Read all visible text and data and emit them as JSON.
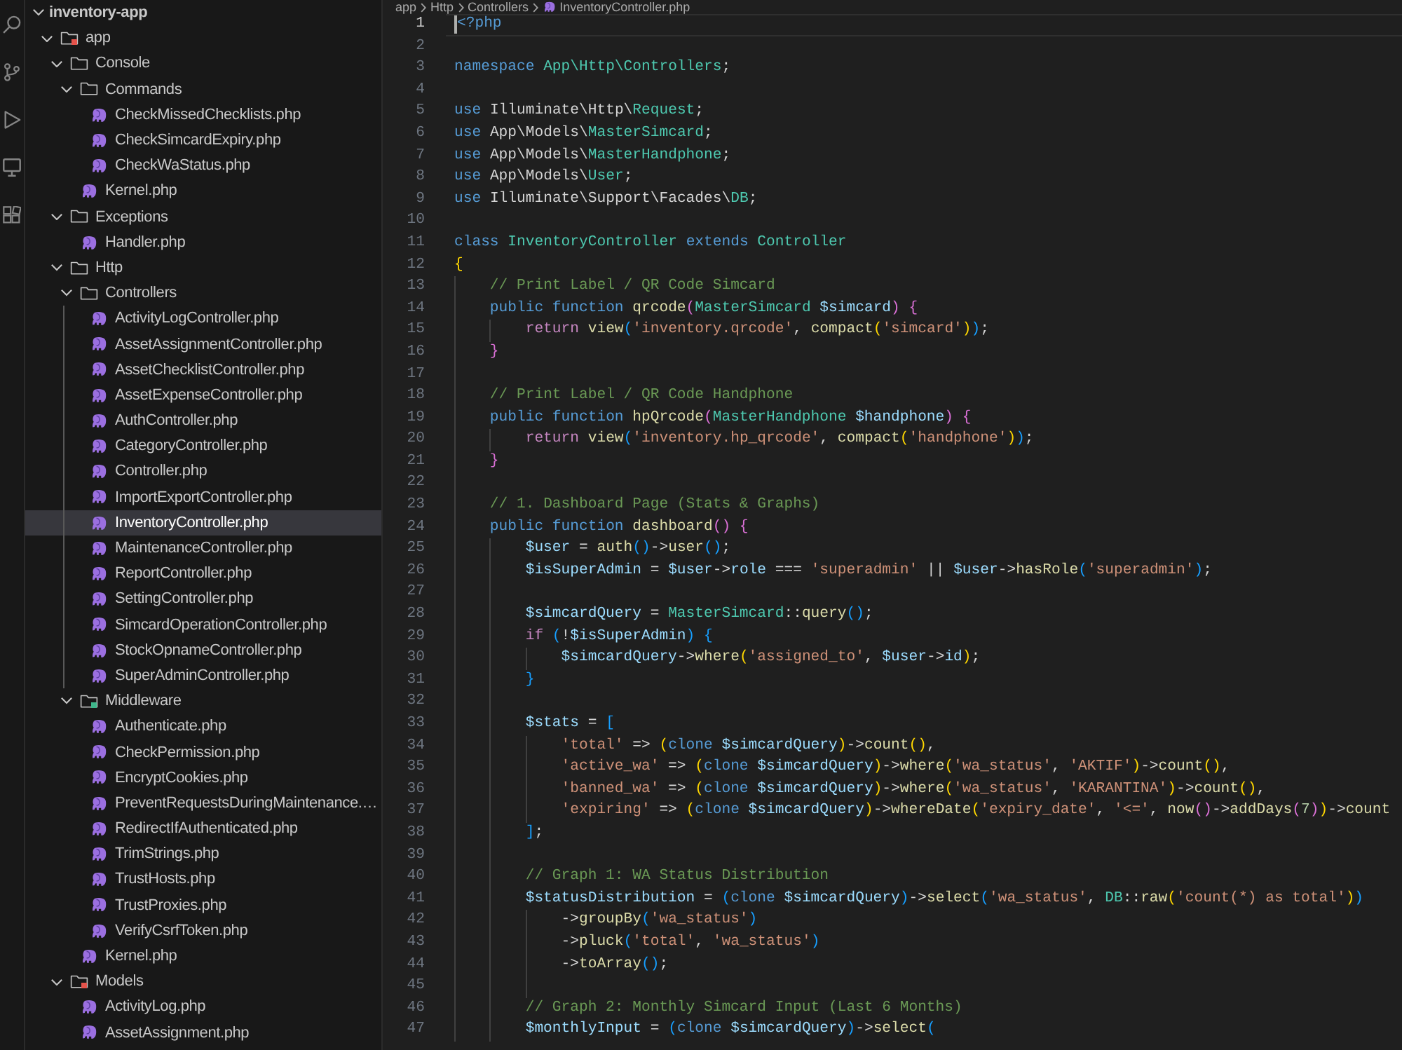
{
  "explorer": {
    "workspace": {
      "name": "inventory-app",
      "expanded": true
    },
    "tree": [
      {
        "name": "app",
        "kind": "folder",
        "expanded": true,
        "selected": false,
        "color": "#e5534b",
        "children": [
          {
            "name": "Console",
            "kind": "folder",
            "expanded": true,
            "selected": false,
            "children": [
              {
                "name": "Commands",
                "kind": "folder",
                "expanded": true,
                "selected": false,
                "children": [
                  {
                    "name": "CheckMissedChecklists.php",
                    "kind": "file",
                    "selected": false
                  },
                  {
                    "name": "CheckSimcardExpiry.php",
                    "kind": "file",
                    "selected": false
                  },
                  {
                    "name": "CheckWaStatus.php",
                    "kind": "file",
                    "selected": false
                  }
                ]
              },
              {
                "name": "Kernel.php",
                "kind": "file",
                "selected": false
              }
            ]
          },
          {
            "name": "Exceptions",
            "kind": "folder",
            "expanded": true,
            "selected": false,
            "children": [
              {
                "name": "Handler.php",
                "kind": "file",
                "selected": false
              }
            ]
          },
          {
            "name": "Http",
            "kind": "folder",
            "expanded": true,
            "selected": false,
            "children": [
              {
                "name": "Controllers",
                "kind": "folder",
                "expanded": true,
                "selected": false,
                "children": [
                  {
                    "name": "ActivityLogController.php",
                    "kind": "file",
                    "selected": false
                  },
                  {
                    "name": "AssetAssignmentController.php",
                    "kind": "file",
                    "selected": false
                  },
                  {
                    "name": "AssetChecklistController.php",
                    "kind": "file",
                    "selected": false
                  },
                  {
                    "name": "AssetExpenseController.php",
                    "kind": "file",
                    "selected": false
                  },
                  {
                    "name": "AuthController.php",
                    "kind": "file",
                    "selected": false
                  },
                  {
                    "name": "CategoryController.php",
                    "kind": "file",
                    "selected": false
                  },
                  {
                    "name": "Controller.php",
                    "kind": "file",
                    "selected": false
                  },
                  {
                    "name": "ImportExportController.php",
                    "kind": "file",
                    "selected": false
                  },
                  {
                    "name": "InventoryController.php",
                    "kind": "file",
                    "selected": true
                  },
                  {
                    "name": "MaintenanceController.php",
                    "kind": "file",
                    "selected": false
                  },
                  {
                    "name": "ReportController.php",
                    "kind": "file",
                    "selected": false
                  },
                  {
                    "name": "SettingController.php",
                    "kind": "file",
                    "selected": false
                  },
                  {
                    "name": "SimcardOperationController.php",
                    "kind": "file",
                    "selected": false
                  },
                  {
                    "name": "StockOpnameController.php",
                    "kind": "file",
                    "selected": false
                  },
                  {
                    "name": "SuperAdminController.php",
                    "kind": "file",
                    "selected": false
                  }
                ]
              },
              {
                "name": "Middleware",
                "kind": "folder",
                "expanded": true,
                "selected": false,
                "color": "#3fb68b",
                "children": [
                  {
                    "name": "Authenticate.php",
                    "kind": "file",
                    "selected": false
                  },
                  {
                    "name": "CheckPermission.php",
                    "kind": "file",
                    "selected": false
                  },
                  {
                    "name": "EncryptCookies.php",
                    "kind": "file",
                    "selected": false
                  },
                  {
                    "name": "PreventRequestsDuringMaintenance.…",
                    "kind": "file",
                    "selected": false
                  },
                  {
                    "name": "RedirectIfAuthenticated.php",
                    "kind": "file",
                    "selected": false
                  },
                  {
                    "name": "TrimStrings.php",
                    "kind": "file",
                    "selected": false
                  },
                  {
                    "name": "TrustHosts.php",
                    "kind": "file",
                    "selected": false
                  },
                  {
                    "name": "TrustProxies.php",
                    "kind": "file",
                    "selected": false
                  },
                  {
                    "name": "VerifyCsrfToken.php",
                    "kind": "file",
                    "selected": false
                  }
                ]
              },
              {
                "name": "Kernel.php",
                "kind": "file",
                "selected": false
              }
            ]
          },
          {
            "name": "Models",
            "kind": "folder",
            "expanded": true,
            "selected": false,
            "color": "#e5534b",
            "children": [
              {
                "name": "ActivityLog.php",
                "kind": "file",
                "selected": false
              },
              {
                "name": "AssetAssignment.php",
                "kind": "file",
                "selected": false
              }
            ]
          }
        ]
      }
    ]
  },
  "editor": {
    "breadcrumb": [
      "app",
      "Http",
      "Controllers",
      "InventoryController.php"
    ],
    "lines": [
      {
        "number": "1",
        "current": true,
        "tokens": [
          {
            "kind": "keyword",
            "text": "<?php"
          }
        ]
      },
      {
        "number": "2",
        "current": false
      },
      {
        "number": "3",
        "current": false,
        "tokens": [
          {
            "kind": "keyword",
            "text": "namespace "
          },
          {
            "kind": "type",
            "text": "App\\Http\\Controllers"
          },
          {
            "kind": "plain",
            "text": ";"
          }
        ]
      },
      {
        "number": "4",
        "current": false
      },
      {
        "number": "5",
        "current": false,
        "tokens": [
          {
            "kind": "keyword",
            "text": "use "
          },
          {
            "kind": "plain",
            "text": "Illuminate\\Http\\"
          },
          {
            "kind": "type",
            "text": "Request"
          },
          {
            "kind": "plain",
            "text": ";"
          }
        ]
      },
      {
        "number": "6",
        "current": false,
        "tokens": [
          {
            "kind": "keyword",
            "text": "use "
          },
          {
            "kind": "plain",
            "text": "App\\Models\\"
          },
          {
            "kind": "type",
            "text": "MasterSimcard"
          },
          {
            "kind": "plain",
            "text": ";"
          }
        ]
      },
      {
        "number": "7",
        "current": false,
        "tokens": [
          {
            "kind": "keyword",
            "text": "use "
          },
          {
            "kind": "plain",
            "text": "App\\Models\\"
          },
          {
            "kind": "type",
            "text": "MasterHandphone"
          },
          {
            "kind": "plain",
            "text": ";"
          }
        ]
      },
      {
        "number": "8",
        "current": false,
        "tokens": [
          {
            "kind": "keyword",
            "text": "use "
          },
          {
            "kind": "plain",
            "text": "App\\Models\\"
          },
          {
            "kind": "type",
            "text": "User"
          },
          {
            "kind": "plain",
            "text": ";"
          }
        ]
      },
      {
        "number": "9",
        "current": false,
        "tokens": [
          {
            "kind": "keyword",
            "text": "use "
          },
          {
            "kind": "plain",
            "text": "Illuminate\\Support\\Facades\\"
          },
          {
            "kind": "type",
            "text": "DB"
          },
          {
            "kind": "plain",
            "text": ";"
          }
        ]
      },
      {
        "number": "10",
        "current": false
      },
      {
        "number": "11",
        "current": false,
        "tokens": [
          {
            "kind": "keyword",
            "text": "class "
          },
          {
            "kind": "type",
            "text": "InventoryController "
          },
          {
            "kind": "keyword",
            "text": "extends "
          },
          {
            "kind": "type",
            "text": "Controller"
          }
        ]
      },
      {
        "number": "12",
        "current": false,
        "tokens": [
          {
            "kind": "bracket1",
            "text": "{"
          }
        ]
      },
      {
        "number": "13",
        "current": false,
        "tokens": [
          {
            "kind": "comment",
            "text": "    // Print Label / QR Code Simcard"
          }
        ]
      },
      {
        "number": "14",
        "current": false,
        "tokens": [
          {
            "kind": "keyword",
            "text": "    public function "
          },
          {
            "kind": "function",
            "text": "qrcode"
          },
          {
            "kind": "bracket2",
            "text": "("
          },
          {
            "kind": "type",
            "text": "MasterSimcard "
          },
          {
            "kind": "variable",
            "text": "$simcard"
          },
          {
            "kind": "bracket2",
            "text": ") {"
          }
        ]
      },
      {
        "number": "15",
        "current": false,
        "tokens": [
          {
            "kind": "control",
            "text": "        return "
          },
          {
            "kind": "function",
            "text": "view"
          },
          {
            "kind": "bracket3",
            "text": "("
          },
          {
            "kind": "string",
            "text": "'inventory.qrcode'"
          },
          {
            "kind": "plain",
            "text": ", "
          },
          {
            "kind": "function",
            "text": "compact"
          },
          {
            "kind": "bracket1",
            "text": "("
          },
          {
            "kind": "string",
            "text": "'simcard'"
          },
          {
            "kind": "bracket1",
            "text": ")"
          },
          {
            "kind": "bracket3",
            "text": ")"
          },
          {
            "kind": "plain",
            "text": ";"
          }
        ]
      },
      {
        "number": "16",
        "current": false,
        "tokens": [
          {
            "kind": "bracket2",
            "text": "    }"
          }
        ]
      },
      {
        "number": "17",
        "current": false
      },
      {
        "number": "18",
        "current": false,
        "tokens": [
          {
            "kind": "comment",
            "text": "    // Print Label / QR Code Handphone"
          }
        ]
      },
      {
        "number": "19",
        "current": false,
        "tokens": [
          {
            "kind": "keyword",
            "text": "    public function "
          },
          {
            "kind": "function",
            "text": "hpQrcode"
          },
          {
            "kind": "bracket2",
            "text": "("
          },
          {
            "kind": "type",
            "text": "MasterHandphone "
          },
          {
            "kind": "variable",
            "text": "$handphone"
          },
          {
            "kind": "bracket2",
            "text": ") {"
          }
        ]
      },
      {
        "number": "20",
        "current": false,
        "tokens": [
          {
            "kind": "control",
            "text": "        return "
          },
          {
            "kind": "function",
            "text": "view"
          },
          {
            "kind": "bracket3",
            "text": "("
          },
          {
            "kind": "string",
            "text": "'inventory.hp_qrcode'"
          },
          {
            "kind": "plain",
            "text": ", "
          },
          {
            "kind": "function",
            "text": "compact"
          },
          {
            "kind": "bracket1",
            "text": "("
          },
          {
            "kind": "string",
            "text": "'handphone'"
          },
          {
            "kind": "bracket1",
            "text": ")"
          },
          {
            "kind": "bracket3",
            "text": ")"
          },
          {
            "kind": "plain",
            "text": ";"
          }
        ]
      },
      {
        "number": "21",
        "current": false,
        "tokens": [
          {
            "kind": "bracket2",
            "text": "    }"
          }
        ]
      },
      {
        "number": "22",
        "current": false
      },
      {
        "number": "23",
        "current": false,
        "tokens": [
          {
            "kind": "comment",
            "text": "    // 1. Dashboard Page (Stats & Graphs)"
          }
        ]
      },
      {
        "number": "24",
        "current": false,
        "tokens": [
          {
            "kind": "keyword",
            "text": "    public function "
          },
          {
            "kind": "function",
            "text": "dashboard"
          },
          {
            "kind": "bracket2",
            "text": "() {"
          }
        ]
      },
      {
        "number": "25",
        "current": false,
        "tokens": [
          {
            "kind": "variable",
            "text": "        $user"
          },
          {
            "kind": "plain",
            "text": " = "
          },
          {
            "kind": "function",
            "text": "auth"
          },
          {
            "kind": "bracket3",
            "text": "()"
          },
          {
            "kind": "plain",
            "text": "->"
          },
          {
            "kind": "function",
            "text": "user"
          },
          {
            "kind": "bracket3",
            "text": "()"
          },
          {
            "kind": "plain",
            "text": ";"
          }
        ]
      },
      {
        "number": "26",
        "current": false,
        "tokens": [
          {
            "kind": "variable",
            "text": "        $isSuperAdmin"
          },
          {
            "kind": "plain",
            "text": " = "
          },
          {
            "kind": "variable",
            "text": "$user"
          },
          {
            "kind": "plain",
            "text": "->"
          },
          {
            "kind": "variable",
            "text": "role"
          },
          {
            "kind": "plain",
            "text": " === "
          },
          {
            "kind": "string",
            "text": "'superadmin'"
          },
          {
            "kind": "plain",
            "text": " || "
          },
          {
            "kind": "variable",
            "text": "$user"
          },
          {
            "kind": "plain",
            "text": "->"
          },
          {
            "kind": "function",
            "text": "hasRole"
          },
          {
            "kind": "bracket3",
            "text": "("
          },
          {
            "kind": "string",
            "text": "'superadmin'"
          },
          {
            "kind": "bracket3",
            "text": ")"
          },
          {
            "kind": "plain",
            "text": ";"
          }
        ]
      },
      {
        "number": "27",
        "current": false
      },
      {
        "number": "28",
        "current": false,
        "tokens": [
          {
            "kind": "variable",
            "text": "        $simcardQuery"
          },
          {
            "kind": "plain",
            "text": " = "
          },
          {
            "kind": "type",
            "text": "MasterSimcard"
          },
          {
            "kind": "plain",
            "text": "::"
          },
          {
            "kind": "function",
            "text": "query"
          },
          {
            "kind": "bracket3",
            "text": "()"
          },
          {
            "kind": "plain",
            "text": ";"
          }
        ]
      },
      {
        "number": "29",
        "current": false,
        "tokens": [
          {
            "kind": "control",
            "text": "        if "
          },
          {
            "kind": "bracket3",
            "text": "("
          },
          {
            "kind": "plain",
            "text": "!"
          },
          {
            "kind": "variable",
            "text": "$isSuperAdmin"
          },
          {
            "kind": "bracket3",
            "text": ") {"
          }
        ]
      },
      {
        "number": "30",
        "current": false,
        "tokens": [
          {
            "kind": "variable",
            "text": "            $simcardQuery"
          },
          {
            "kind": "plain",
            "text": "->"
          },
          {
            "kind": "function",
            "text": "where"
          },
          {
            "kind": "bracket1",
            "text": "("
          },
          {
            "kind": "string",
            "text": "'assigned_to'"
          },
          {
            "kind": "plain",
            "text": ", "
          },
          {
            "kind": "variable",
            "text": "$user"
          },
          {
            "kind": "plain",
            "text": "->"
          },
          {
            "kind": "variable",
            "text": "id"
          },
          {
            "kind": "bracket1",
            "text": ")"
          },
          {
            "kind": "plain",
            "text": ";"
          }
        ]
      },
      {
        "number": "31",
        "current": false,
        "tokens": [
          {
            "kind": "bracket3",
            "text": "        }"
          }
        ]
      },
      {
        "number": "32",
        "current": false
      },
      {
        "number": "33",
        "current": false,
        "tokens": [
          {
            "kind": "variable",
            "text": "        $stats"
          },
          {
            "kind": "plain",
            "text": " = "
          },
          {
            "kind": "bracket3",
            "text": "["
          }
        ]
      },
      {
        "number": "34",
        "current": false,
        "tokens": [
          {
            "kind": "string",
            "text": "            'total'"
          },
          {
            "kind": "plain",
            "text": " => "
          },
          {
            "kind": "bracket1",
            "text": "("
          },
          {
            "kind": "keyword",
            "text": "clone "
          },
          {
            "kind": "variable",
            "text": "$simcardQuery"
          },
          {
            "kind": "bracket1",
            "text": ")"
          },
          {
            "kind": "plain",
            "text": "->"
          },
          {
            "kind": "function",
            "text": "count"
          },
          {
            "kind": "bracket1",
            "text": "()"
          },
          {
            "kind": "plain",
            "text": ","
          }
        ]
      },
      {
        "number": "35",
        "current": false,
        "tokens": [
          {
            "kind": "string",
            "text": "            'active_wa'"
          },
          {
            "kind": "plain",
            "text": " => "
          },
          {
            "kind": "bracket1",
            "text": "("
          },
          {
            "kind": "keyword",
            "text": "clone "
          },
          {
            "kind": "variable",
            "text": "$simcardQuery"
          },
          {
            "kind": "bracket1",
            "text": ")"
          },
          {
            "kind": "plain",
            "text": "->"
          },
          {
            "kind": "function",
            "text": "where"
          },
          {
            "kind": "bracket1",
            "text": "("
          },
          {
            "kind": "string",
            "text": "'wa_status'"
          },
          {
            "kind": "plain",
            "text": ", "
          },
          {
            "kind": "string",
            "text": "'AKTIF'"
          },
          {
            "kind": "bracket1",
            "text": ")"
          },
          {
            "kind": "plain",
            "text": "->"
          },
          {
            "kind": "function",
            "text": "count"
          },
          {
            "kind": "bracket1",
            "text": "()"
          },
          {
            "kind": "plain",
            "text": ","
          }
        ]
      },
      {
        "number": "36",
        "current": false,
        "tokens": [
          {
            "kind": "string",
            "text": "            'banned_wa'"
          },
          {
            "kind": "plain",
            "text": " => "
          },
          {
            "kind": "bracket1",
            "text": "("
          },
          {
            "kind": "keyword",
            "text": "clone "
          },
          {
            "kind": "variable",
            "text": "$simcardQuery"
          },
          {
            "kind": "bracket1",
            "text": ")"
          },
          {
            "kind": "plain",
            "text": "->"
          },
          {
            "kind": "function",
            "text": "where"
          },
          {
            "kind": "bracket1",
            "text": "("
          },
          {
            "kind": "string",
            "text": "'wa_status'"
          },
          {
            "kind": "plain",
            "text": ", "
          },
          {
            "kind": "string",
            "text": "'KARANTINA'"
          },
          {
            "kind": "bracket1",
            "text": ")"
          },
          {
            "kind": "plain",
            "text": "->"
          },
          {
            "kind": "function",
            "text": "count"
          },
          {
            "kind": "bracket1",
            "text": "()"
          },
          {
            "kind": "plain",
            "text": ","
          }
        ]
      },
      {
        "number": "37",
        "current": false,
        "tokens": [
          {
            "kind": "string",
            "text": "            'expiring'"
          },
          {
            "kind": "plain",
            "text": " => "
          },
          {
            "kind": "bracket1",
            "text": "("
          },
          {
            "kind": "keyword",
            "text": "clone "
          },
          {
            "kind": "variable",
            "text": "$simcardQuery"
          },
          {
            "kind": "bracket1",
            "text": ")"
          },
          {
            "kind": "plain",
            "text": "->"
          },
          {
            "kind": "function",
            "text": "whereDate"
          },
          {
            "kind": "bracket1",
            "text": "("
          },
          {
            "kind": "string",
            "text": "'expiry_date'"
          },
          {
            "kind": "plain",
            "text": ", "
          },
          {
            "kind": "string",
            "text": "'<='"
          },
          {
            "kind": "plain",
            "text": ", "
          },
          {
            "kind": "function",
            "text": "now"
          },
          {
            "kind": "bracket2",
            "text": "()"
          },
          {
            "kind": "plain",
            "text": "->"
          },
          {
            "kind": "function",
            "text": "addDays"
          },
          {
            "kind": "bracket2",
            "text": "("
          },
          {
            "kind": "number",
            "text": "7"
          },
          {
            "kind": "bracket2",
            "text": ")"
          },
          {
            "kind": "bracket1",
            "text": ")"
          },
          {
            "kind": "plain",
            "text": "->"
          },
          {
            "kind": "function",
            "text": "count"
          }
        ]
      },
      {
        "number": "38",
        "current": false,
        "tokens": [
          {
            "kind": "bracket3",
            "text": "        ]"
          },
          {
            "kind": "plain",
            "text": ";"
          }
        ]
      },
      {
        "number": "39",
        "current": false
      },
      {
        "number": "40",
        "current": false,
        "tokens": [
          {
            "kind": "comment",
            "text": "        // Graph 1: WA Status Distribution"
          }
        ]
      },
      {
        "number": "41",
        "current": false,
        "tokens": [
          {
            "kind": "variable",
            "text": "        $statusDistribution"
          },
          {
            "kind": "plain",
            "text": " = "
          },
          {
            "kind": "bracket3",
            "text": "("
          },
          {
            "kind": "keyword",
            "text": "clone "
          },
          {
            "kind": "variable",
            "text": "$simcardQuery"
          },
          {
            "kind": "bracket3",
            "text": ")"
          },
          {
            "kind": "plain",
            "text": "->"
          },
          {
            "kind": "function",
            "text": "select"
          },
          {
            "kind": "bracket3",
            "text": "("
          },
          {
            "kind": "string",
            "text": "'wa_status'"
          },
          {
            "kind": "plain",
            "text": ", "
          },
          {
            "kind": "type",
            "text": "DB"
          },
          {
            "kind": "plain",
            "text": "::"
          },
          {
            "kind": "function",
            "text": "raw"
          },
          {
            "kind": "bracket1",
            "text": "("
          },
          {
            "kind": "string",
            "text": "'count(*) as total'"
          },
          {
            "kind": "bracket1",
            "text": ")"
          },
          {
            "kind": "bracket3",
            "text": ")"
          }
        ]
      },
      {
        "number": "42",
        "current": false,
        "tokens": [
          {
            "kind": "plain",
            "text": "            ->"
          },
          {
            "kind": "function",
            "text": "groupBy"
          },
          {
            "kind": "bracket3",
            "text": "("
          },
          {
            "kind": "string",
            "text": "'wa_status'"
          },
          {
            "kind": "bracket3",
            "text": ")"
          }
        ]
      },
      {
        "number": "43",
        "current": false,
        "tokens": [
          {
            "kind": "plain",
            "text": "            ->"
          },
          {
            "kind": "function",
            "text": "pluck"
          },
          {
            "kind": "bracket3",
            "text": "("
          },
          {
            "kind": "string",
            "text": "'total'"
          },
          {
            "kind": "plain",
            "text": ", "
          },
          {
            "kind": "string",
            "text": "'wa_status'"
          },
          {
            "kind": "bracket3",
            "text": ")"
          }
        ]
      },
      {
        "number": "44",
        "current": false,
        "tokens": [
          {
            "kind": "plain",
            "text": "            ->"
          },
          {
            "kind": "function",
            "text": "toArray"
          },
          {
            "kind": "bracket3",
            "text": "()"
          },
          {
            "kind": "plain",
            "text": ";"
          }
        ]
      },
      {
        "number": "45",
        "current": false
      },
      {
        "number": "46",
        "current": false,
        "tokens": [
          {
            "kind": "comment",
            "text": "        // Graph 2: Monthly Simcard Input (Last 6 Months)"
          }
        ]
      },
      {
        "number": "47",
        "current": false,
        "tokens": [
          {
            "kind": "variable",
            "text": "        $monthlyInput"
          },
          {
            "kind": "plain",
            "text": " = "
          },
          {
            "kind": "bracket3",
            "text": "("
          },
          {
            "kind": "keyword",
            "text": "clone "
          },
          {
            "kind": "variable",
            "text": "$simcardQuery"
          },
          {
            "kind": "bracket3",
            "text": ")"
          },
          {
            "kind": "plain",
            "text": "->"
          },
          {
            "kind": "function",
            "text": "select"
          },
          {
            "kind": "bracket3",
            "text": "("
          }
        ]
      }
    ]
  }
}
